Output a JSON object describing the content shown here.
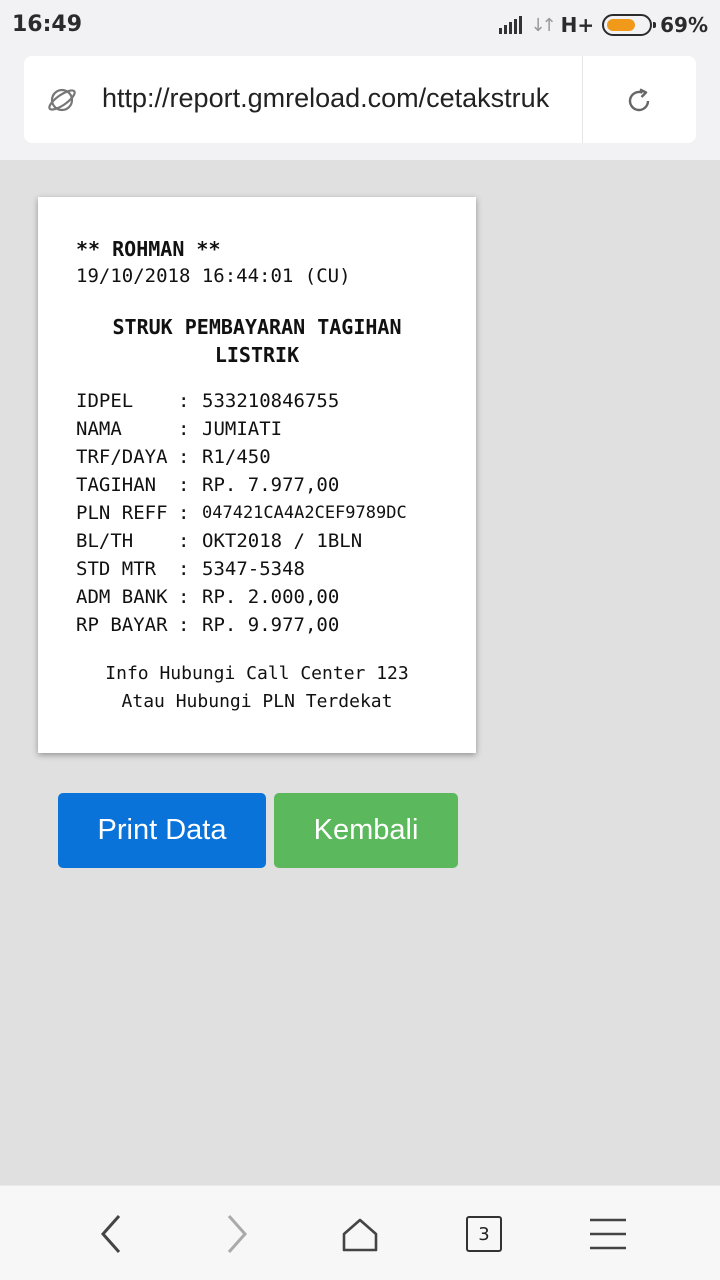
{
  "status_bar": {
    "time": "16:49",
    "network": "H+",
    "battery_percent": "69%",
    "battery_level": 0.69,
    "icons": [
      "signal-icon",
      "data-arrows-icon",
      "battery-icon"
    ]
  },
  "browser": {
    "url": "http://report.gmreload.com/cetakstruk",
    "icons": [
      "site-globe-icon",
      "reload-icon"
    ],
    "tab_count": "3"
  },
  "receipt": {
    "name": "** ROHMAN **",
    "datetime": "19/10/2018 16:44:01 (CU)",
    "title_line1": "STRUK PEMBAYARAN TAGIHAN",
    "title_line2": "LISTRIK",
    "separator": ":",
    "rows": [
      {
        "label": "IDPEL",
        "value": "533210846755"
      },
      {
        "label": "NAMA",
        "value": "JUMIATI"
      },
      {
        "label": "TRF/DAYA",
        "value": "R1/450"
      },
      {
        "label": "TAGIHAN",
        "value": "RP. 7.977,00"
      },
      {
        "label": "PLN REFF",
        "value": "047421CA4A2CEF9789DC"
      },
      {
        "label": "BL/TH",
        "value": "OKT2018 / 1BLN"
      },
      {
        "label": "STD MTR",
        "value": "5347-5348"
      },
      {
        "label": "ADM BANK",
        "value": "RP. 2.000,00"
      },
      {
        "label": "RP BAYAR",
        "value": "RP. 9.977,00"
      }
    ],
    "footer_line1": "Info Hubungi Call Center 123",
    "footer_line2": "Atau Hubungi PLN Terdekat"
  },
  "actions": {
    "print_label": "Print Data",
    "back_label": "Kembali",
    "print_color": "#0a73d9",
    "back_color": "#5cb85c"
  },
  "bottom_nav": {
    "icons": [
      "back-arrow-icon",
      "forward-arrow-icon",
      "home-icon",
      "tabs-icon",
      "menu-icon"
    ]
  }
}
